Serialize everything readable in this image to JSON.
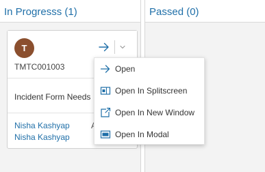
{
  "lanes": [
    {
      "title": "In Progresss (1)"
    },
    {
      "title": "Passed (0)"
    }
  ],
  "card": {
    "avatar_initial": "T",
    "id": "TMTC001003",
    "description": "Incident Form Needs",
    "people": [
      "Nisha Kashyap",
      "Nisha Kashyap"
    ],
    "extra": "As"
  },
  "menu": {
    "items": [
      {
        "label": "Open",
        "icon": "arrow-right-icon"
      },
      {
        "label": "Open In Splitscreen",
        "icon": "splitscreen-icon"
      },
      {
        "label": "Open In New Window",
        "icon": "new-window-icon"
      },
      {
        "label": "Open In Modal",
        "icon": "modal-icon"
      }
    ]
  },
  "colors": {
    "accent": "#1f6fa8",
    "avatar": "#8b4f2e",
    "lane_background": "#f3f3f3"
  }
}
